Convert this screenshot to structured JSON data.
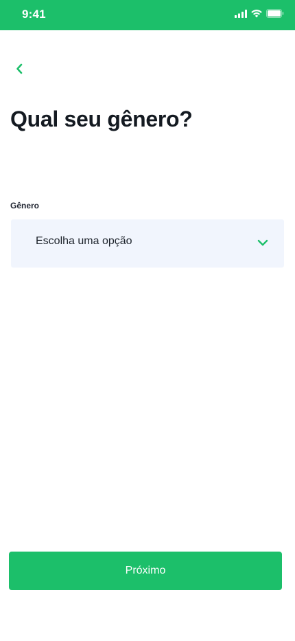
{
  "status_bar": {
    "time": "9:41",
    "background_color": "#1cbf6a",
    "icons": [
      "cellular-signal-icon",
      "wifi-icon",
      "battery-icon"
    ]
  },
  "navigation": {
    "back_icon": "chevron-left-icon"
  },
  "page": {
    "title": "Qual seu gênero?"
  },
  "form": {
    "gender_label": "Gênero",
    "gender_select_value": "Escolha uma opção",
    "gender_select_icon": "chevron-down-icon"
  },
  "footer": {
    "next_label": "Próximo"
  },
  "colors": {
    "accent": "#1cbf6a",
    "input_background": "#f1f5fd",
    "title_text": "#141a21"
  }
}
